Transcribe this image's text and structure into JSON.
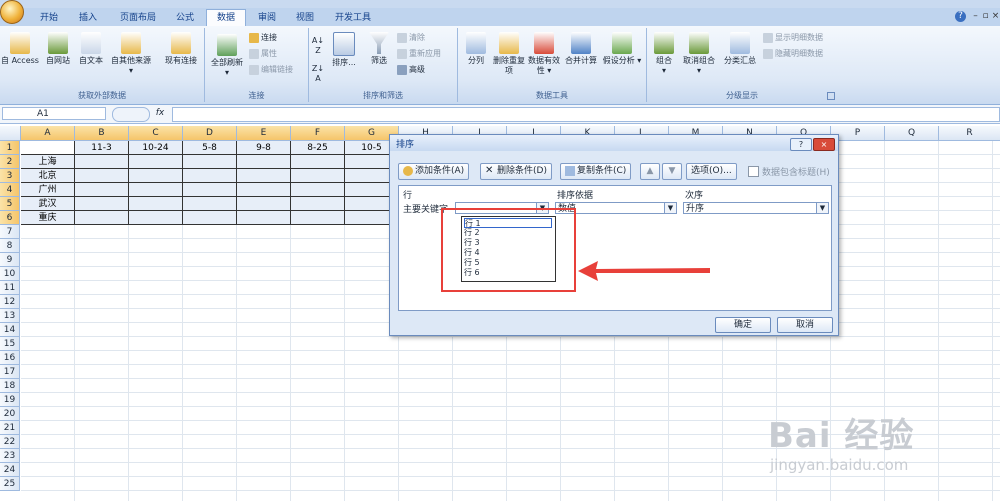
{
  "window": {
    "title_fragment": "Microsoft Excel"
  },
  "tabs": [
    "开始",
    "插入",
    "页面布局",
    "公式",
    "数据",
    "审阅",
    "视图",
    "开发工具"
  ],
  "active_tab": "数据",
  "ribbon": {
    "external_data": {
      "label": "获取外部数据",
      "items": [
        "自 Access",
        "自网站",
        "自文本",
        "自其他来源",
        "现有连接"
      ]
    },
    "connections": {
      "label": "连接",
      "refresh_all": "全部刷新",
      "small": [
        "连接",
        "属性",
        "编辑链接"
      ]
    },
    "sort_filter": {
      "label": "排序和筛选",
      "sort": "排序...",
      "filter": "筛选",
      "small": [
        "清除",
        "重新应用",
        "高级"
      ]
    },
    "data_tools": {
      "label": "数据工具",
      "items": [
        "分列",
        "删除重复项",
        "数据有效性",
        "合并计算",
        "假设分析"
      ]
    },
    "outline": {
      "label": "分级显示",
      "items": [
        "组合",
        "取消组合",
        "分类汇总"
      ],
      "small": [
        "显示明细数据",
        "隐藏明细数据"
      ]
    }
  },
  "formula_bar": {
    "name_box": "A1",
    "fx": "fx",
    "value": ""
  },
  "columns": [
    "A",
    "B",
    "C",
    "D",
    "E",
    "F",
    "G",
    "H",
    "I",
    "J",
    "K",
    "L",
    "M",
    "N",
    "O",
    "P",
    "Q",
    "R"
  ],
  "rows": [
    "1",
    "2",
    "3",
    "4",
    "5",
    "6",
    "7",
    "8",
    "9",
    "10",
    "11",
    "12",
    "13",
    "14",
    "15",
    "16",
    "17",
    "18",
    "19",
    "20",
    "21",
    "22",
    "23",
    "24",
    "25"
  ],
  "sheet": {
    "header_row": [
      "",
      "11-3",
      "10-24",
      "5-8",
      "9-8",
      "8-25",
      "10-5"
    ],
    "cities": [
      "上海",
      "北京",
      "广州",
      "武汉",
      "重庆"
    ]
  },
  "sort_dialog": {
    "title": "排序",
    "help": "?",
    "close": "×",
    "buttons": {
      "add": "添加条件(A)",
      "delete": "删除条件(D)",
      "copy": "复制条件(C)",
      "options": "选项(O)...",
      "has_header": "数据包含标题(H)"
    },
    "headers": {
      "row": "行",
      "sort_on": "排序依据",
      "order": "次序"
    },
    "row_label": "主要关键字",
    "sort_on_value": "数值",
    "order_value": "升序",
    "dropdown_options": [
      "行 1",
      "行 2",
      "行 3",
      "行 4",
      "行 5",
      "行 6"
    ],
    "ok": "确定",
    "cancel": "取消"
  },
  "watermark": {
    "brand": "Bai 经验",
    "url": "jingyan.baidu.com"
  },
  "colors": {
    "accent": "#15428b",
    "highlight_box": "#e8403a",
    "header_selected": "#f5c56a"
  }
}
